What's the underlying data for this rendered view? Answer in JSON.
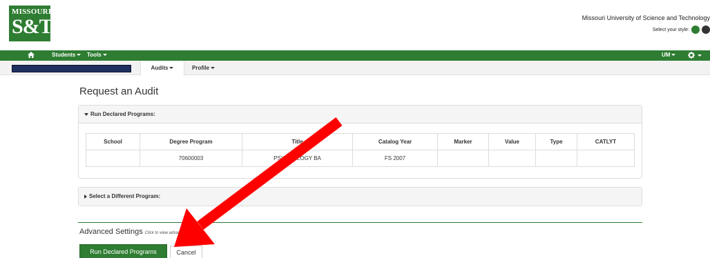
{
  "header": {
    "logo_line1": "MISSOURI",
    "logo_line2": "S&T",
    "university": "Missouri University of Science and Technology",
    "style_label": "Select your style:",
    "style_swatches": [
      "#2e7d32",
      "#333333"
    ]
  },
  "navbar": {
    "home_icon": "home-icon",
    "students": "Students",
    "tools": "Tools",
    "um": "UM",
    "settings_icon": "gear-icon"
  },
  "subnav": {
    "audits": "Audits",
    "profile": "Profile"
  },
  "main": {
    "title": "Request an Audit",
    "declared_panel": "Run Declared Programs:",
    "table": {
      "headers": [
        "School",
        "Degree Program",
        "Title",
        "Catalog Year",
        "Marker",
        "Value",
        "Type",
        "CATLYT"
      ],
      "rows": [
        [
          "",
          "70600003",
          "PSYCHOLOGY BA",
          "FS 2007",
          "",
          "",
          "",
          ""
        ]
      ]
    },
    "different_panel": "Select a Different Program:",
    "advanced": "Advanced Settings",
    "advanced_hint": "Click to view advanced options.",
    "run_button": "Run Declared Programs",
    "cancel_button": "Cancel"
  },
  "annotation": {
    "arrow_color": "#ff0000"
  }
}
